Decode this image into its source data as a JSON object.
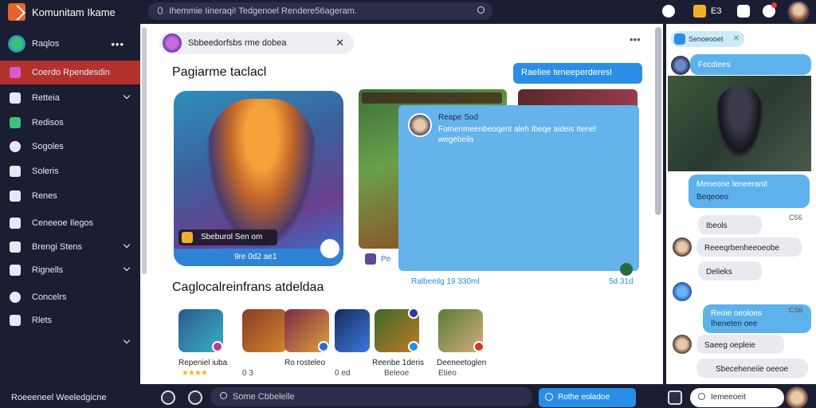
{
  "app": {
    "title": "Komunitam Ikame"
  },
  "topbar": {
    "search_placeholder": "Ihemmie Iineraqi! Tedgenoel Rendere56ageram.",
    "coins": "E3"
  },
  "sidebar": {
    "items": [
      {
        "label": "Raqlos"
      },
      {
        "label": "Coerdo Rpendesdin"
      },
      {
        "label": "Retteia"
      },
      {
        "label": "Redisos"
      },
      {
        "label": "Sogoles"
      },
      {
        "label": "Soleris"
      },
      {
        "label": "Renes"
      },
      {
        "label": "Ceneeoe Ilegos"
      },
      {
        "label": "Brengi Stens"
      },
      {
        "label": "Rignells"
      },
      {
        "label": "Concelrs"
      },
      {
        "label": "Rlets"
      }
    ],
    "footer": "Roeeeneel Weeledgicne"
  },
  "main": {
    "chip_text": "Sbbeedorfsbs rme dobea",
    "section1_title": "Pagiarme taclacl",
    "blue_pill": "Raeliee teneeperderesl",
    "featured": {
      "label": "Sbeburol Sen om",
      "footer": "9re 0d2 ae1"
    },
    "tooltip": {
      "name": "Reape Sod",
      "text": "Fomenmeenbeoqent aleh Ibeqe aideis Itenel wegebeils"
    },
    "under_tip": "Pe",
    "time_left": "Ralbeeilg 19 330ml",
    "time_right": "5d 31d",
    "section2_title": "Caglocalreinfrans atdeldaa",
    "heroes": [
      {
        "name": "Repeniel iuba",
        "stat": "★★★★"
      },
      {
        "name": "",
        "stat": "0 3"
      },
      {
        "name": "Ro rosteleo",
        "stat": "0 ed"
      },
      {
        "name": "",
        "stat": ""
      },
      {
        "name": "Reenbe 1deris",
        "stat": "Beleoe"
      },
      {
        "name": "Deeneetoglen",
        "stat": "Etieo"
      }
    ]
  },
  "right": {
    "tag": "Senoeooet",
    "msg1": "Fecdiees",
    "msg2_line1": "Meneone Ieneeranit",
    "msg2_line2": "Beqeoeo",
    "time1": "C56",
    "msg3": "Ibeols",
    "msg4": "Reeeqrbenheeoeobe",
    "msg5": "Delieks",
    "msg6_line1": "Reoie oeoloes",
    "msg6_line2": "Iheneten oee",
    "time2": "CS6",
    "msg7": "Saeeg oepleie",
    "msg8": "Sbeceheneiie oeeoe",
    "input_placeholder": "Iemeeoeit"
  },
  "bottombar": {
    "search_placeholder": "Some Cbbelelle",
    "button_label": "Rothe eoladoe"
  }
}
